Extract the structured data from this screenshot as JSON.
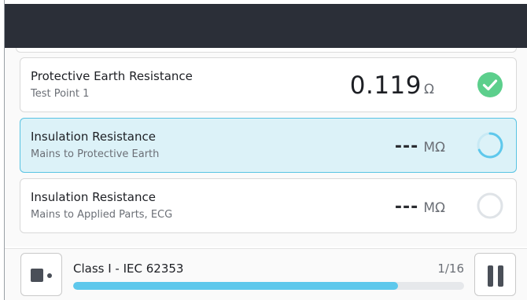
{
  "colors": {
    "header_bg": "#2b2f38",
    "accent": "#5ec8ec",
    "active_card_bg": "#dcf2f8",
    "active_card_border": "#58c3e3",
    "pass_green": "#5ccf8c",
    "pending_ring": "#dfe3e7"
  },
  "tests": [
    {
      "title": "Protective Earth Resistance",
      "subtitle": "Test Point 1",
      "value": "0.119",
      "unit": "Ω",
      "status": "passed",
      "status_icon": "check-circle-icon"
    },
    {
      "title": "Insulation Resistance",
      "subtitle": "Mains to Protective Earth",
      "value": "---",
      "unit": "MΩ",
      "status": "running",
      "status_icon": "spinner-icon"
    },
    {
      "title": "Insulation Resistance",
      "subtitle": "Mains to Applied Parts, ECG",
      "value": "---",
      "unit": "MΩ",
      "status": "pending",
      "status_icon": "empty-circle-icon"
    }
  ],
  "footer": {
    "sequence_name": "Class I - IEC 62353",
    "step_counter": "1/16",
    "progress_fraction": 0.83,
    "stop_icon": "stop-icon",
    "pause_icon": "pause-icon"
  }
}
